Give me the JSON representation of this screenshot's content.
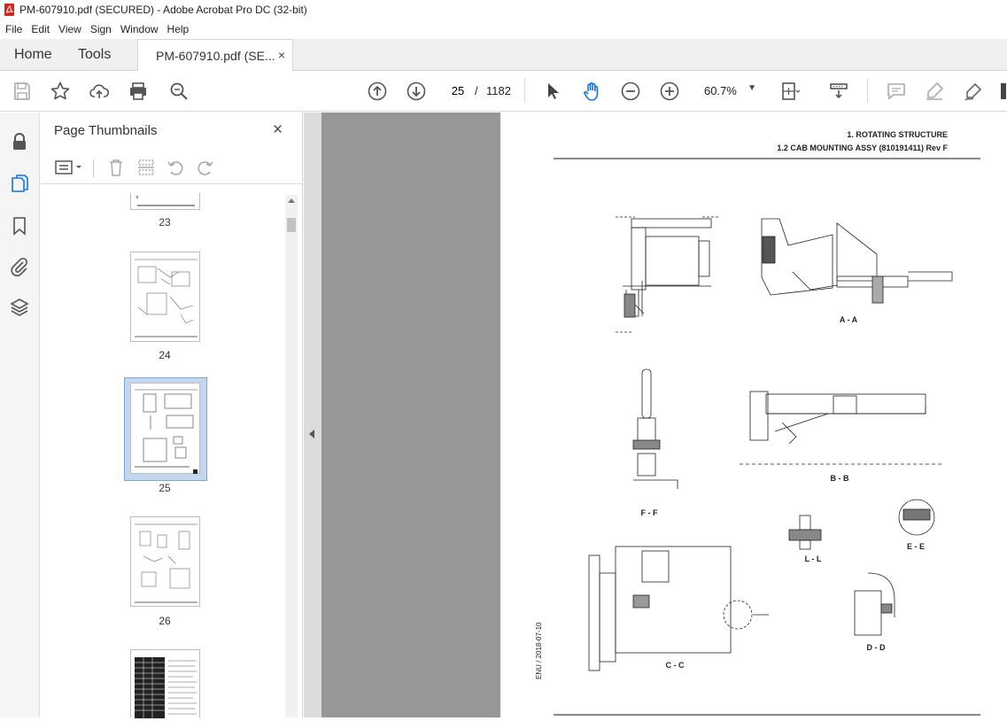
{
  "window": {
    "title": "PM-607910.pdf (SECURED) - Adobe Acrobat Pro DC (32-bit)"
  },
  "menu": [
    "File",
    "Edit",
    "View",
    "Sign",
    "Window",
    "Help"
  ],
  "tabs": {
    "home": "Home",
    "tools": "Tools",
    "document": "PM-607910.pdf (SE...",
    "close": "×"
  },
  "toolbar": {
    "icons": [
      "save-icon",
      "star-icon",
      "upload-cloud-icon",
      "print-icon",
      "find-zoom-icon",
      "prev-page-icon",
      "next-page-icon",
      "select-arrow-icon",
      "hand-tool-icon",
      "zoom-out-icon",
      "zoom-in-icon",
      "page-fit-icon",
      "scroll-mode-icon",
      "comment-icon",
      "highlight-icon",
      "sign-icon"
    ],
    "page_current": "25",
    "page_sep": "/",
    "page_total": "1182",
    "zoom": "60.7%"
  },
  "left_rail": [
    "lock-icon",
    "page-thumbnails-icon",
    "bookmark-icon",
    "attachment-icon",
    "layers-icon"
  ],
  "thumbnails": {
    "title": "Page Thumbnails",
    "close": "×",
    "pages": [
      {
        "num": "23"
      },
      {
        "num": "24"
      },
      {
        "num": "25",
        "selected": true
      },
      {
        "num": "26"
      }
    ]
  },
  "document_page": {
    "header_line1": "1. ROTATING STRUCTURE",
    "header_line2": "1.2 CAB MOUNTING ASSY (810191411) Rev F",
    "side_stamp": "ENU / 2018-07-10",
    "views": {
      "aa": "A - A",
      "bb": "B - B",
      "ff": "F - F",
      "ll": "L - L",
      "ee": "E - E",
      "cc": "C - C",
      "dd": "D - D"
    }
  }
}
